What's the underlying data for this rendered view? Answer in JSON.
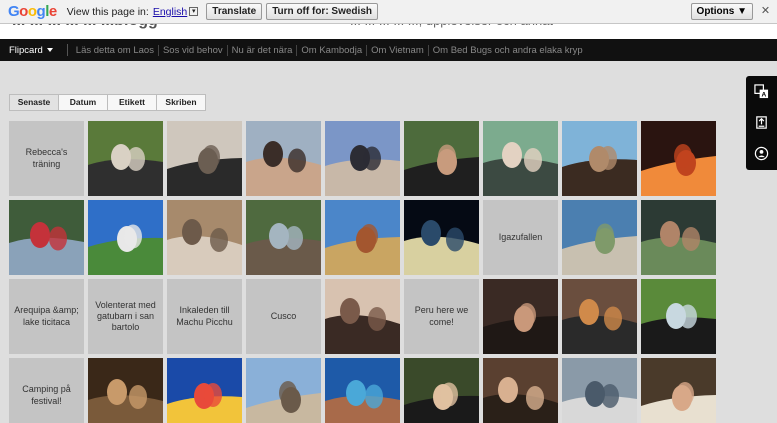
{
  "translate_bar": {
    "label": "View this page in:",
    "language": "English",
    "translate_button": "Translate",
    "turn_off_button": "Turn off for: Swedish",
    "options_button": "Options ▼",
    "close": "✕"
  },
  "site": {
    "title": "... ... ... ... ... ...blogg",
    "description": "... ... ... ... ..., upplevelser och annat"
  },
  "nav": {
    "view_label": "Flipcard",
    "links": [
      "Läs detta om Laos",
      "Sos vid behov",
      "Nu är det nära",
      "Om Kambodja",
      "Om Vietnam",
      "Om Bed Bugs och andra elaka kryp"
    ]
  },
  "tabs": [
    "Senaste",
    "Datum",
    "Etikett",
    "Skriben"
  ],
  "cards": [
    {
      "type": "text",
      "text": "Rebecca's träning"
    },
    {
      "type": "photo",
      "palette": [
        "#5a7a3a",
        "#d9d1c4",
        "#2f2f2f"
      ]
    },
    {
      "type": "photo",
      "palette": [
        "#cfc7bd",
        "#6b5e52",
        "#2a2a2a"
      ]
    },
    {
      "type": "photo",
      "palette": [
        "#9fb0c2",
        "#3a2d28",
        "#c9a58b"
      ]
    },
    {
      "type": "photo",
      "palette": [
        "#7b96c7",
        "#2c2c34",
        "#c8b8a8"
      ]
    },
    {
      "type": "photo",
      "palette": [
        "#4d6b3c",
        "#c89b7d",
        "#1f1f1f"
      ]
    },
    {
      "type": "photo",
      "palette": [
        "#7cab8e",
        "#e3d2c2",
        "#3c4a42"
      ]
    },
    {
      "type": "photo",
      "palette": [
        "#7fb3d8",
        "#b08a6a",
        "#3b2b21"
      ]
    },
    {
      "type": "photo",
      "palette": [
        "#2a1410",
        "#c0441e",
        "#f08a3a"
      ]
    },
    {
      "type": "photo",
      "palette": [
        "#3f5c3a",
        "#c4323a",
        "#8aa2b9"
      ]
    },
    {
      "type": "photo",
      "palette": [
        "#2f6fc8",
        "#e8e8e8",
        "#4a8a3a"
      ]
    },
    {
      "type": "photo",
      "palette": [
        "#a78a6c",
        "#6d5a4a",
        "#d8cbbc"
      ]
    },
    {
      "type": "photo",
      "palette": [
        "#4f6a3f",
        "#a4b5c0",
        "#6a5a4a"
      ]
    },
    {
      "type": "photo",
      "palette": [
        "#4b86c9",
        "#a3562f",
        "#c9a562"
      ]
    },
    {
      "type": "photo",
      "palette": [
        "#050a14",
        "#2a4a6a",
        "#d8d0a0"
      ]
    },
    {
      "type": "text",
      "text": "Igazufallen"
    },
    {
      "type": "photo",
      "palette": [
        "#4b7fb0",
        "#7f9a6a",
        "#c8c0b0"
      ]
    },
    {
      "type": "photo",
      "palette": [
        "#2c3a34",
        "#b08468",
        "#6a8a5a"
      ]
    },
    {
      "type": "text",
      "text": "Arequipa &amp; lake ticitaca"
    },
    {
      "type": "text",
      "text": "Volenterat med gatubarn i san bartolo"
    },
    {
      "type": "text",
      "text": "Inkaleden till Machu Picchu"
    },
    {
      "type": "text",
      "text": "Cusco"
    },
    {
      "type": "photo",
      "palette": [
        "#d8c2b0",
        "#7a5a4a",
        "#3a2a24"
      ]
    },
    {
      "type": "text",
      "text": "Peru here we come!"
    },
    {
      "type": "photo",
      "palette": [
        "#3a2a24",
        "#c9987a",
        "#1f1815"
      ]
    },
    {
      "type": "photo",
      "palette": [
        "#6a4e3e",
        "#d08a4a",
        "#2a2a2a"
      ]
    },
    {
      "type": "photo",
      "palette": [
        "#5a8a3a",
        "#c8d8e0",
        "#1a1a1a"
      ]
    },
    {
      "type": "text",
      "text": "Camping på festival!"
    },
    {
      "type": "photo",
      "palette": [
        "#3a2818",
        "#c89a6a",
        "#7a5a3a"
      ]
    },
    {
      "type": "photo",
      "palette": [
        "#1a4aa8",
        "#e84a3a",
        "#f2c43a"
      ]
    },
    {
      "type": "photo",
      "palette": [
        "#8ab0d8",
        "#6a5a4a",
        "#c8b8a0"
      ]
    },
    {
      "type": "photo",
      "palette": [
        "#1e5aa8",
        "#4aa8d8",
        "#a86a4a"
      ]
    },
    {
      "type": "photo",
      "palette": [
        "#3a4a2a",
        "#e0c0a0",
        "#1a1a1a"
      ]
    },
    {
      "type": "photo",
      "palette": [
        "#5a4030",
        "#d8b090",
        "#2a2018"
      ]
    },
    {
      "type": "photo",
      "palette": [
        "#8a9aa8",
        "#4a5a6a",
        "#d8d8d8"
      ]
    },
    {
      "type": "photo",
      "palette": [
        "#4a3a2a",
        "#d8a888",
        "#e8e0d0"
      ]
    }
  ],
  "side_panel": {
    "icons": [
      "translate-icon",
      "share-icon",
      "account-icon"
    ]
  },
  "colors": {
    "page_bg": "#dedede",
    "nav_bg": "#111111",
    "tab_active": "#e2e2e2",
    "text_card_bg": "#c4c4c4"
  }
}
